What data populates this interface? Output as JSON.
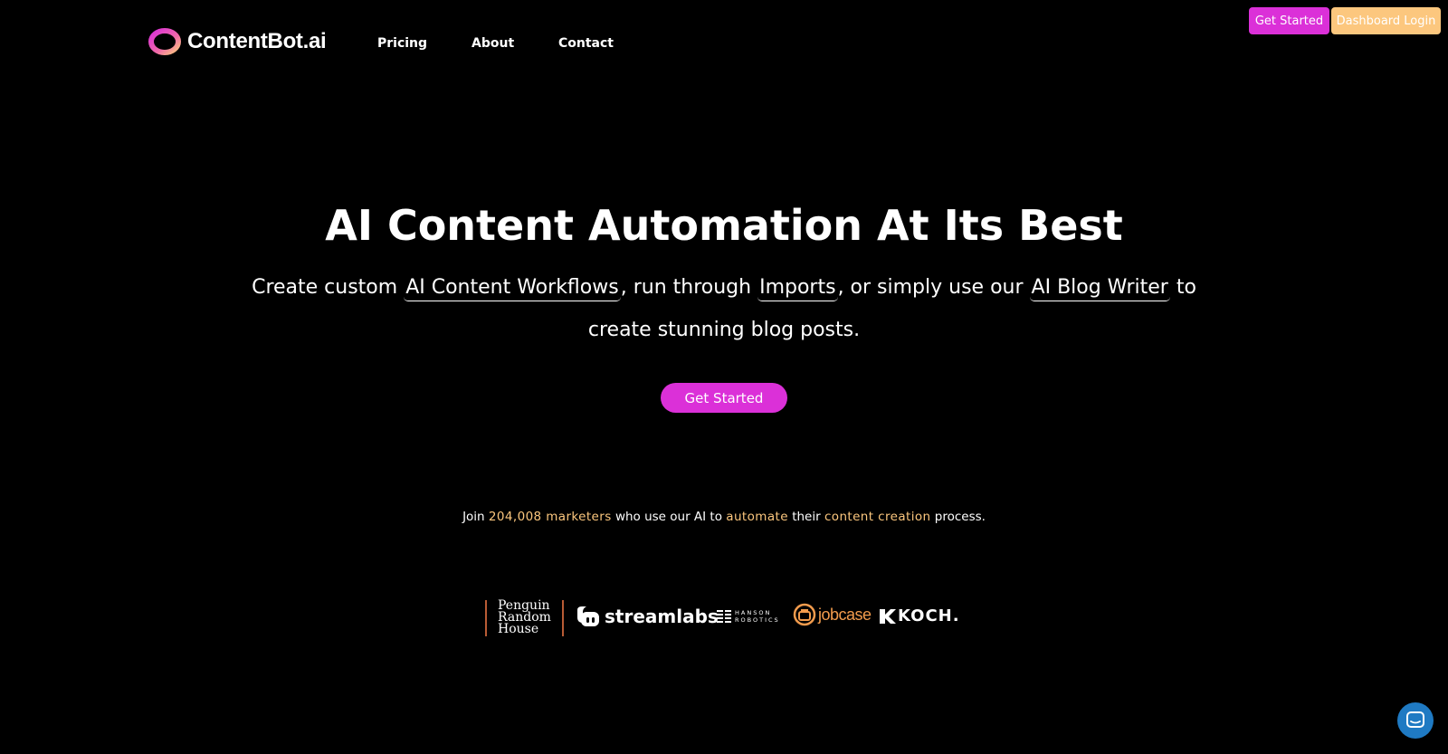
{
  "brand": {
    "name": "ContentBot.ai",
    "colors": {
      "background": "#000000",
      "primary": "#db30d8",
      "accent": "#fcc77e",
      "chat": "#1f7ac3"
    }
  },
  "nav": {
    "items": [
      {
        "label": "Pricing"
      },
      {
        "label": "About"
      },
      {
        "label": "Contact"
      }
    ]
  },
  "top_actions": {
    "get_started": "Get Started",
    "dashboard_login": "Dashboard Login"
  },
  "hero": {
    "title": "AI Content Automation At Its Best",
    "sub_prefix": "Create custom",
    "link_workflows": "AI Content Workflows",
    "sub_mid1": ", run through",
    "link_imports": "Imports",
    "sub_mid2": ", or simply use our",
    "link_blog_writer": "AI Blog Writer",
    "sub_suffix": "to create stunning blog posts.",
    "cta": "Get Started"
  },
  "social_proof": {
    "p1": "Join",
    "count": "204,008 marketers",
    "p2": "who use our AI to",
    "h2": "automate",
    "p3": "their",
    "h3": "content creation",
    "p4": "process."
  },
  "client_logos": {
    "penguin": [
      "Penguin",
      "Random",
      "House"
    ],
    "streamlabs": "streamlabs",
    "hanson": [
      "HANSON",
      "ROBOTICS"
    ],
    "jobcase": "jobcase",
    "koch": "KOCH."
  },
  "icons": {
    "logo": "contentbot-ring-icon",
    "chat": "chat-icon"
  }
}
